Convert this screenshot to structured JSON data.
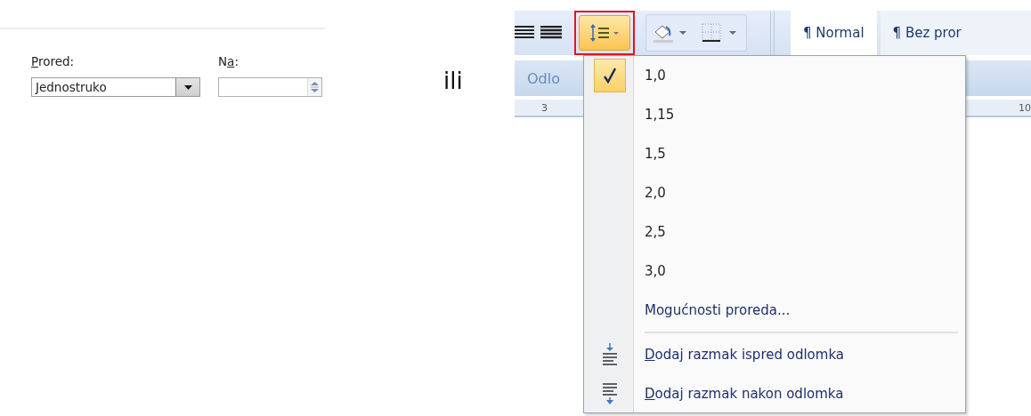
{
  "dialog": {
    "spacing": {
      "label": {
        "key": "P",
        "post": "rored:"
      },
      "value": "Jednostruko"
    },
    "at": {
      "label": {
        "pre": "N",
        "key": "a",
        "post": ":"
      }
    }
  },
  "separator_text": "ili",
  "ribbon": {
    "line_spacing_button": {
      "open": true,
      "marked": true
    },
    "styles": [
      "¶ Normal",
      "¶ Bez pror"
    ],
    "group_label": "Odlo",
    "ruler": [
      "3",
      "10"
    ]
  },
  "menu": {
    "items": [
      {
        "kind": "value",
        "text": "1,0",
        "selected": true
      },
      {
        "kind": "value",
        "text": "1,15",
        "selected": false
      },
      {
        "kind": "value",
        "text": "1,5",
        "selected": false
      },
      {
        "kind": "value",
        "text": "2,0",
        "selected": false
      },
      {
        "kind": "value",
        "text": "2,5",
        "selected": false
      },
      {
        "kind": "value",
        "text": "3,0",
        "selected": false
      },
      {
        "kind": "options",
        "text": "Mogućnosti proreda..."
      },
      {
        "kind": "space-before",
        "key": "D",
        "text": "odaj razmak ispred odlomka"
      },
      {
        "kind": "space-after",
        "key": "D",
        "text": "odaj razmak nakon odlomka"
      }
    ]
  }
}
